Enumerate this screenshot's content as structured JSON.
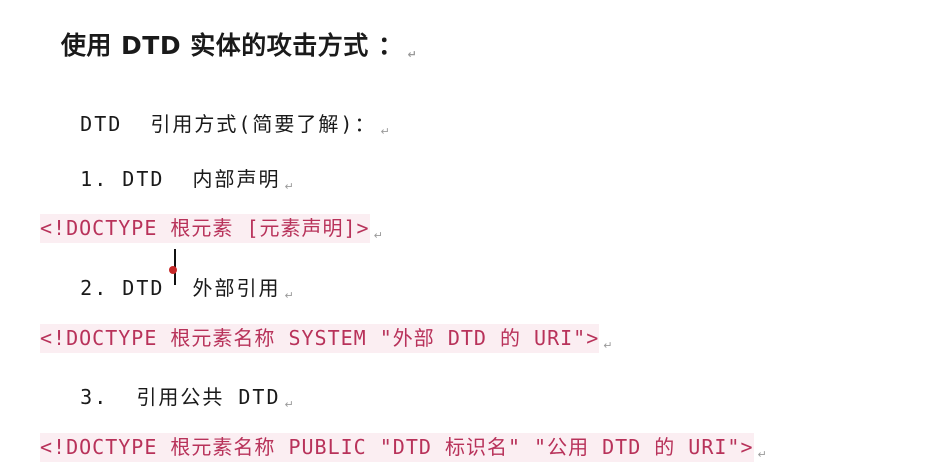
{
  "document": {
    "heading": "使用 DTD 实体的攻击方式 ：",
    "intro": "DTD  引用方式(简要了解)：",
    "item1": "1. DTD  内部声明",
    "code1": "<!DOCTYPE 根元素 [元素声明]>",
    "item2": "2. DTD  外部引用",
    "code2": "<!DOCTYPE 根元素名称 SYSTEM \"外部 DTD 的 URI\">",
    "item3": "3.  引用公共 DTD",
    "code3": "<!DOCTYPE 根元素名称 PUBLIC \"DTD 标识名\" \"公用 DTD 的 URI\">",
    "paragraph_mark": "↵"
  }
}
